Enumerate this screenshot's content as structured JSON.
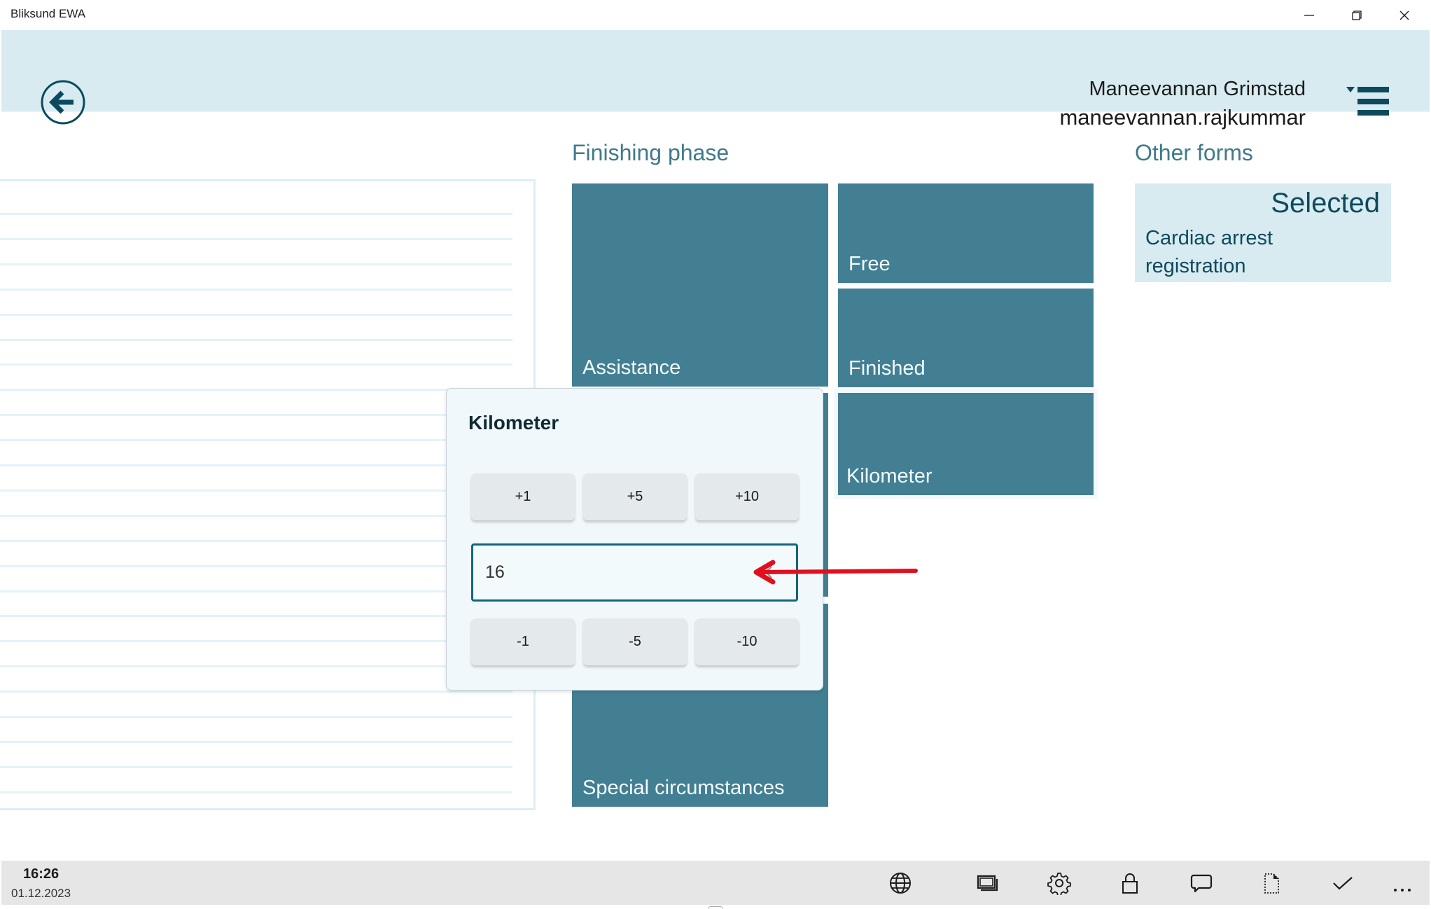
{
  "window": {
    "title": "Bliksund EWA",
    "controls": [
      "minimize",
      "restore",
      "close"
    ]
  },
  "header": {
    "back_icon": "arrow-left-circle-icon",
    "user_name": "Maneevannan Grimstad",
    "user_login": "maneevannan.rajkummar",
    "menu_icon": "hamburger-dropdown-icon"
  },
  "list_panel": {
    "rows": 24,
    "items": []
  },
  "finishing_phase": {
    "title": "Finishing phase",
    "tiles": [
      {
        "label": "Assistance"
      },
      {
        "label": ""
      },
      {
        "label": "Special circumstances"
      },
      {
        "label": "Free"
      },
      {
        "label": "Finished"
      },
      {
        "label": "Kilometer"
      }
    ]
  },
  "other_forms": {
    "title": "Other forms",
    "cards": [
      {
        "status": "Selected",
        "name": "Cardiac arrest registration"
      }
    ]
  },
  "kilometer_dialog": {
    "title": "Kilometer",
    "increment_buttons": [
      "+1",
      "+5",
      "+10"
    ],
    "decrement_buttons": [
      "-1",
      "-5",
      "-10"
    ],
    "value": "16",
    "clear_icon": "clear-backspace-icon"
  },
  "annotation": {
    "type": "arrow",
    "color": "#e0101f",
    "points_to": "kilometer-input"
  },
  "app_bar": {
    "time": "16:26",
    "date": "01.12.2023",
    "icons": [
      "globe-icon",
      "screens-icon",
      "settings-gear-icon",
      "lock-icon",
      "comment-icon",
      "document-icon",
      "checkmark-icon",
      "more-icon"
    ]
  },
  "colors": {
    "header_bg": "#d7ebf1",
    "tile_bg": "#427f93",
    "accent_text": "#3f7a8c",
    "dark_accent": "#0f4a5c",
    "dialog_bg": "#f1f8fb",
    "appbar_bg": "#e6e6e6"
  }
}
